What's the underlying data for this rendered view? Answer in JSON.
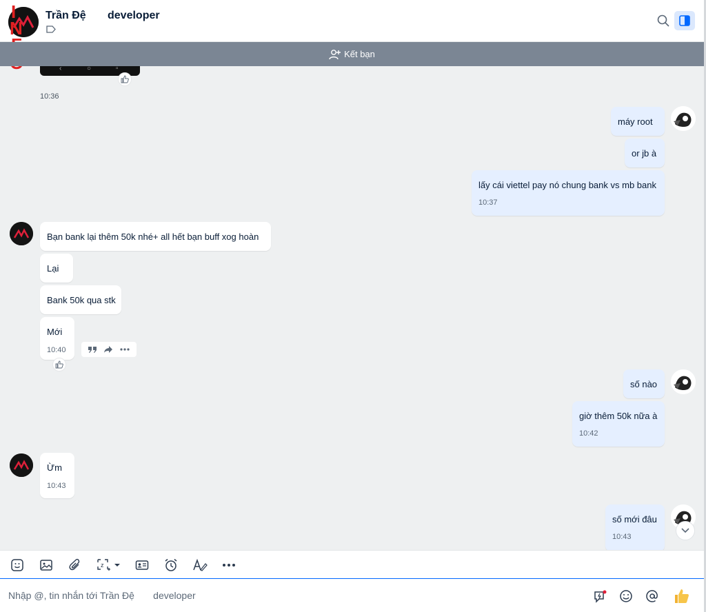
{
  "header": {
    "name": "Trần Đệ",
    "role": "developer",
    "watermark": "INFO"
  },
  "friend_bar": {
    "label": "Kết bạn"
  },
  "chat": {
    "prev_time": "10:36",
    "messages_out_1": [
      "máy  root",
      "or jb à",
      "lấy cái viettel pay nó chung bank vs mb bank"
    ],
    "out_1_time": "10:37",
    "messages_in_1": [
      "Bạn bank lại thêm 50k nhé+ all hết bạn buff xog hoàn",
      "Lại",
      "Bank 50k qua stk",
      "Mới"
    ],
    "in_1_time": "10:40",
    "messages_out_2": [
      "số nào",
      "giờ thêm 50k nữa à"
    ],
    "out_2_time": "10:42",
    "messages_in_2": [
      "Ừm"
    ],
    "in_2_time": "10:43",
    "messages_out_3": [
      "số mới đâu"
    ],
    "out_3_time": "10:43"
  },
  "composer": {
    "placeholder": "Nhập @, tin nhắn tới Trần Đệ       developer"
  },
  "colors": {
    "accent": "#0068ff",
    "bubble_out": "#e5efff",
    "bubble_in": "#ffffff",
    "friend_bar": "#7b8694"
  }
}
